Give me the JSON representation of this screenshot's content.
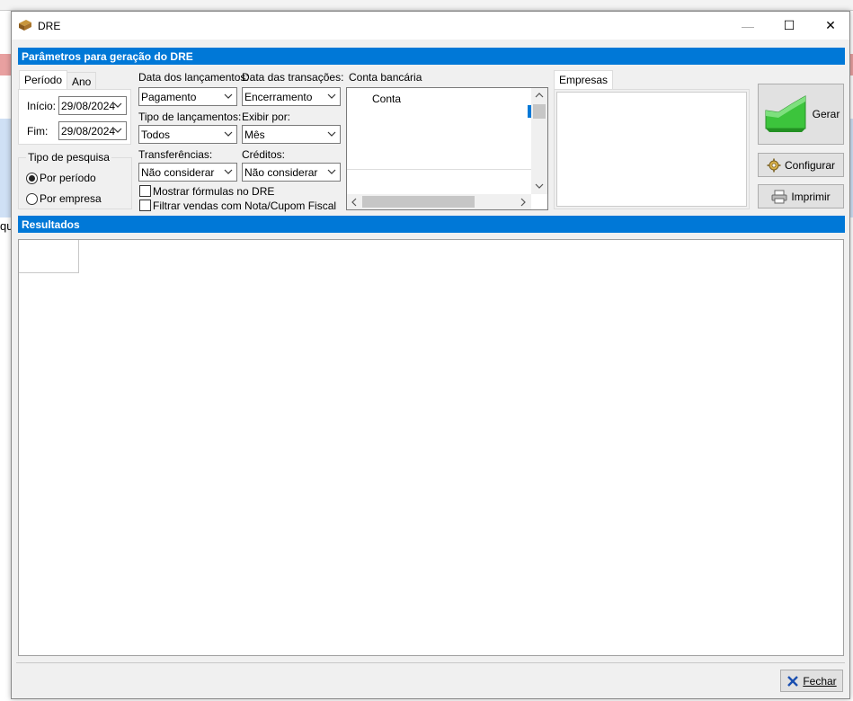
{
  "window": {
    "title": "DRE",
    "minimize_glyph": "—",
    "maximize_glyph": "☐",
    "close_glyph": "✕"
  },
  "background": {
    "left_text": "qu"
  },
  "params": {
    "header": "Parâmetros para geração do DRE",
    "period_tabs": [
      "Período",
      "Ano"
    ],
    "inicio_label": "Início:",
    "inicio_value": "29/08/2024",
    "fim_label": "Fim:",
    "fim_value": "29/08/2024",
    "tipo_pesquisa": {
      "title": "Tipo de pesquisa",
      "options": [
        "Por período",
        "Por empresa"
      ],
      "selected": "Por período"
    },
    "data_lancamentos": {
      "label": "Data dos lançamentos:",
      "value": "Pagamento"
    },
    "data_transacoes": {
      "label": "Data das transações:",
      "value": "Encerramento"
    },
    "tipo_lancamentos": {
      "label": "Tipo de lançamentos:",
      "value": "Todos"
    },
    "exibir_por": {
      "label": "Exibir por:",
      "value": "Mês"
    },
    "transferencias": {
      "label": "Transferências:",
      "value": "Não considerar"
    },
    "creditos": {
      "label": "Créditos:",
      "value": "Não considerar"
    },
    "chk_formulas": "Mostrar fórmulas no DRE",
    "chk_filtrar": "Filtrar vendas com Nota/Cupom Fiscal",
    "conta_bancaria": {
      "label": "Conta bancária",
      "column": "Conta"
    },
    "empresas_tab": "Empresas"
  },
  "buttons": {
    "gerar": "Gerar",
    "configurar": "Configurar",
    "imprimir": "Imprimir",
    "fechar": "Fechar"
  },
  "results": {
    "header": "Resultados"
  },
  "colors": {
    "accent": "#0078d7"
  }
}
